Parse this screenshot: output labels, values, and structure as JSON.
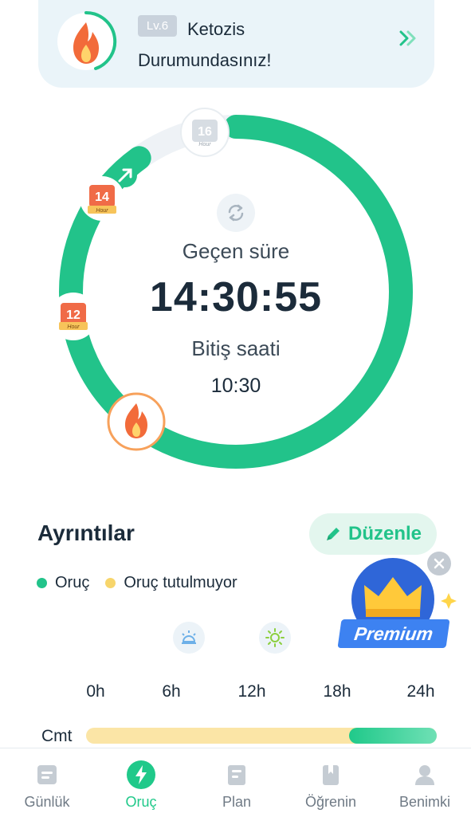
{
  "banner": {
    "level": "Lv.6",
    "title": "Ketozis Durumundasınız!"
  },
  "timer": {
    "elapsed_label": "Geçen süre",
    "elapsed_time": "14:30:55",
    "end_label": "Bitiş saati",
    "end_time": "10:30",
    "progress_fraction": 0.9
  },
  "milestones": [
    {
      "hours": "16",
      "unit": "Hour"
    },
    {
      "hours": "14",
      "unit": "Hour"
    },
    {
      "hours": "12",
      "unit": "Hour"
    }
  ],
  "details": {
    "title": "Ayrıntılar",
    "edit_label": "Düzenle",
    "legend": [
      {
        "label": "Oruç",
        "color": "#22c38a"
      },
      {
        "label": "Oruç tutulmuyor",
        "color": "#f7d56b"
      }
    ],
    "hours": [
      "0h",
      "6h",
      "12h",
      "18h",
      "24h"
    ],
    "day": "Cmt",
    "fasting_fraction": 0.25
  },
  "premium": {
    "label": "Premium"
  },
  "tabs": [
    {
      "label": "Günlük",
      "icon": "journal-icon"
    },
    {
      "label": "Oruç",
      "icon": "bolt-icon"
    },
    {
      "label": "Plan",
      "icon": "plan-icon"
    },
    {
      "label": "Öğrenin",
      "icon": "bookmark-icon"
    },
    {
      "label": "Benimki",
      "icon": "person-icon"
    }
  ],
  "colors": {
    "accent": "#22c38a",
    "track": "#eef2f6",
    "flame": "#f26b3a",
    "premium": "#3d82f1"
  }
}
